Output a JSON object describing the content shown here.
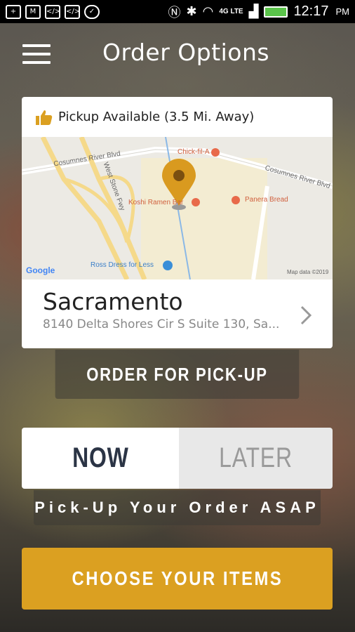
{
  "status_bar": {
    "time": "12:17",
    "ampm": "PM",
    "network": "4G LTE",
    "icons": [
      "add-icon",
      "gmail-icon",
      "code-icon",
      "code-icon",
      "check-icon",
      "nfc-icon",
      "bluetooth-icon",
      "wifi-icon",
      "signal-icon",
      "battery-icon"
    ]
  },
  "header": {
    "title": "Order Options"
  },
  "location_card": {
    "pickup_text": "Pickup Available (3.5 Mi. Away)",
    "city": "Sacramento",
    "address": "8140 Delta Shores Cir S Suite 130, Sa...",
    "map": {
      "labels": {
        "cosumnes_left": "Cosumnes River Blvd",
        "cosumnes_right": "Cosumnes River Blvd",
        "west_stone": "West Stone Fwy",
        "chickfila": "Chick-fil-A",
        "koshi": "Koshi Ramen Bar",
        "panera": "Panera Bread",
        "ross": "Ross Dress for Less",
        "google": "Google",
        "map_data": "Map data ©2019"
      }
    }
  },
  "order_button": {
    "label": "ORDER FOR PICK-UP"
  },
  "timing": {
    "now": "NOW",
    "later": "LATER",
    "selected": "now",
    "caption": "Pick-Up Your Order ASAP"
  },
  "choose_button": {
    "label": "CHOOSE YOUR ITEMS"
  },
  "colors": {
    "accent": "#dba021",
    "pin": "#d99a1f",
    "now_text": "#2b3445"
  }
}
